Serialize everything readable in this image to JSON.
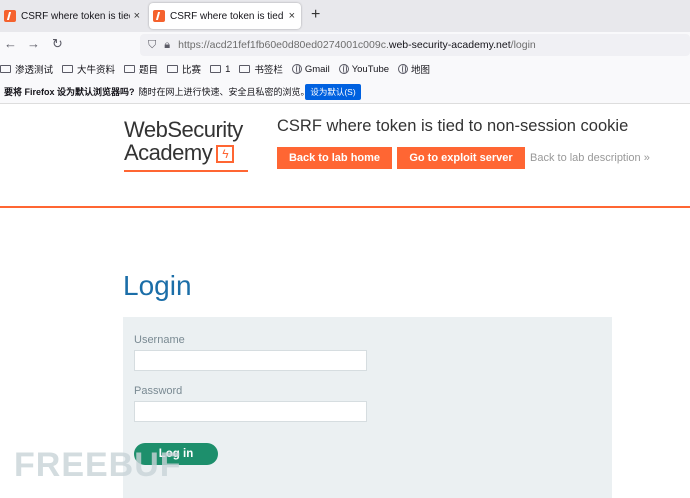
{
  "browser": {
    "tabs": [
      {
        "title": "CSRF where token is tied to n",
        "close": "×"
      },
      {
        "title": "CSRF where token is tied to n",
        "close": "×"
      }
    ],
    "new_tab": "+",
    "nav": {
      "back": "←",
      "forward": "→",
      "reload": "↻"
    },
    "url": {
      "prefix": "https://acd21fef1fb60e0d80ed0274001c009c.",
      "host": "web-security-academy.net",
      "path": "/login"
    },
    "bookmarks": [
      {
        "label": "渗透测试",
        "icon": "folder-icon"
      },
      {
        "label": "大牛资料",
        "icon": "folder-icon"
      },
      {
        "label": "题目",
        "icon": "folder-icon"
      },
      {
        "label": "比赛",
        "icon": "folder-icon"
      },
      {
        "label": "1",
        "icon": "folder-icon"
      },
      {
        "label": "书签栏",
        "icon": "folder-icon"
      },
      {
        "label": "Gmail",
        "icon": "globe-icon"
      },
      {
        "label": "YouTube",
        "icon": "globe-icon"
      },
      {
        "label": "地图",
        "icon": "globe-icon"
      }
    ],
    "notification": {
      "text": "要将 Firefox 设为默认浏览器吗?",
      "sub": "随时在网上进行快速、安全且私密的浏览。",
      "button": "设为默认(S)"
    }
  },
  "site": {
    "logo_line1": "WebSecurity",
    "logo_line2": "Academy",
    "logo_bolt": "ϟ",
    "lab_title": "CSRF where token is tied to non-session cookie",
    "back_home": "Back to lab home",
    "exploit": "Go to exploit server",
    "back_desc": "Back to lab description »"
  },
  "login": {
    "title": "Login",
    "username_label": "Username",
    "password_label": "Password",
    "submit": "Log in"
  },
  "watermark": "FREEBUF",
  "colors": {
    "accent": "#ff6633",
    "link": "#1b6ea8",
    "submit": "#1d8f6c",
    "panel": "#ebf0f2"
  }
}
